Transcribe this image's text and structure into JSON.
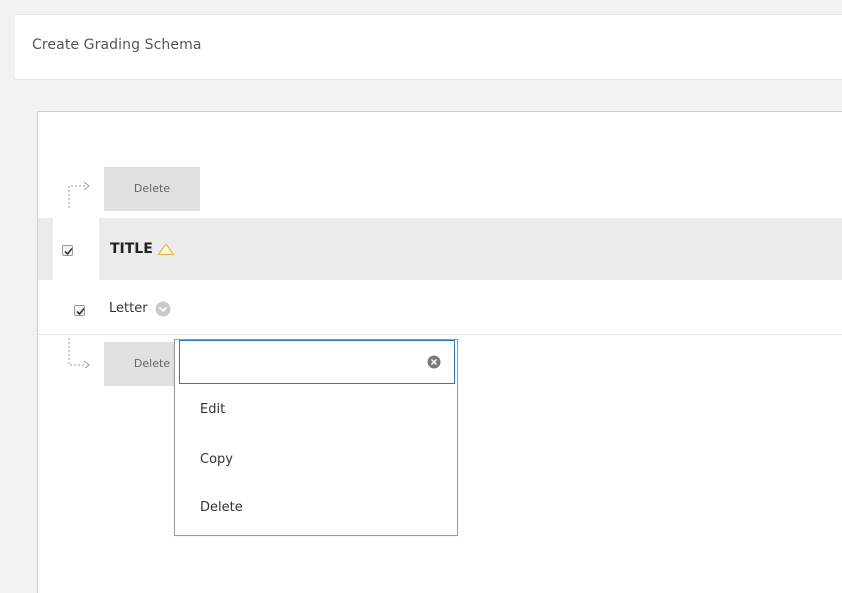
{
  "header": {
    "title": "Create Grading Schema"
  },
  "actions": {
    "top_delete_label": "Delete",
    "bottom_delete_label": "Delete"
  },
  "table": {
    "column_header": "TITLE",
    "header_checked": true,
    "rows": [
      {
        "title": "Letter",
        "checked": true
      }
    ]
  },
  "context_menu": {
    "search_value": "",
    "items": [
      "Edit",
      "Copy",
      "Delete"
    ]
  },
  "icons": {
    "sort": "triangle-up-sort-icon",
    "row_menu": "chevron-down-circle-icon",
    "clear": "clear-circle-x-icon",
    "arrow": "dashed-corner-arrow-icon"
  },
  "colors": {
    "input_focus_border": "#2b7bbf",
    "sort_icon": "#e0b84a",
    "button_bg": "#e0e0e0"
  }
}
